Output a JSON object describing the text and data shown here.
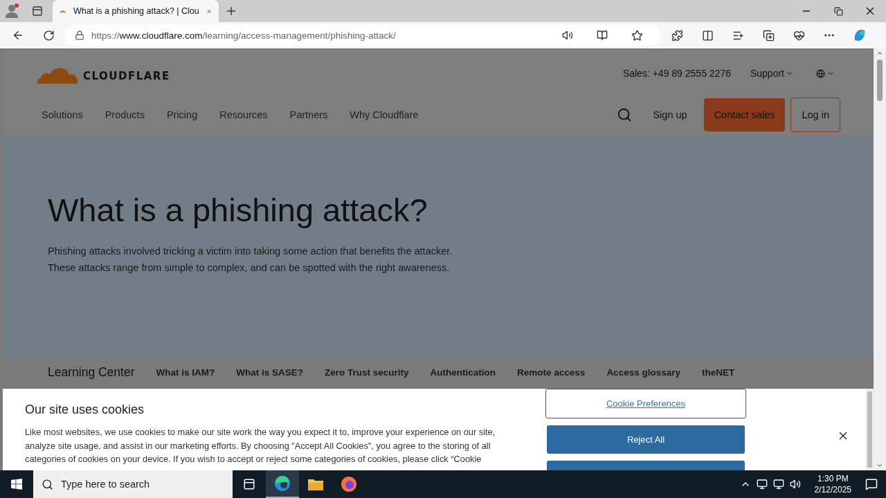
{
  "browser": {
    "tabs": [
      {
        "title": "What is a phishing attack? | Clou",
        "selected": true
      }
    ],
    "url": {
      "scheme": "https://",
      "host": "www.cloudflare.com",
      "path": "/learning/access-management/phishing-attack/"
    }
  },
  "site": {
    "logo": "CLOUDFLARE",
    "sales": "Sales: +49 89 2555 2276",
    "support": "Support",
    "nav": [
      "Solutions",
      "Products",
      "Pricing",
      "Resources",
      "Partners",
      "Why Cloudflare"
    ],
    "sign_up": "Sign up",
    "contact_sales": "Contact sales",
    "log_in": "Log in"
  },
  "hero": {
    "title": "What is a phishing attack?",
    "lines": [
      "Phishing attacks involved tricking a victim into taking some action that benefits the attacker.",
      "These attacks range from simple to complex, and can be spotted with the right awareness."
    ]
  },
  "learning_center": {
    "title": "Learning Center",
    "links": [
      "What is IAM?",
      "What is SASE?",
      "Zero Trust security",
      "Authentication",
      "Remote access",
      "Access glossary",
      "theNET"
    ]
  },
  "cookie_banner": {
    "title": "Our site uses cookies",
    "text": "Like most websites, we use cookies to make our site work the way you expect it to, improve your experience on our site, analyze site usage, and assist in our marketing efforts. By choosing \"Accept All Cookies\", you agree to the storing of all categories of cookies on your device. If you wish to accept or reject some categories of cookies, please click “Cookie",
    "buttons": [
      {
        "kind": "outline",
        "label": "Cookie Preferences"
      },
      {
        "kind": "solid",
        "label": "Reject All"
      },
      {
        "kind": "solid"
      }
    ]
  },
  "taskbar": {
    "search": {
      "placeholder": "Type here to search"
    },
    "time": "1:30 PM",
    "date": "2/12/2025"
  }
}
